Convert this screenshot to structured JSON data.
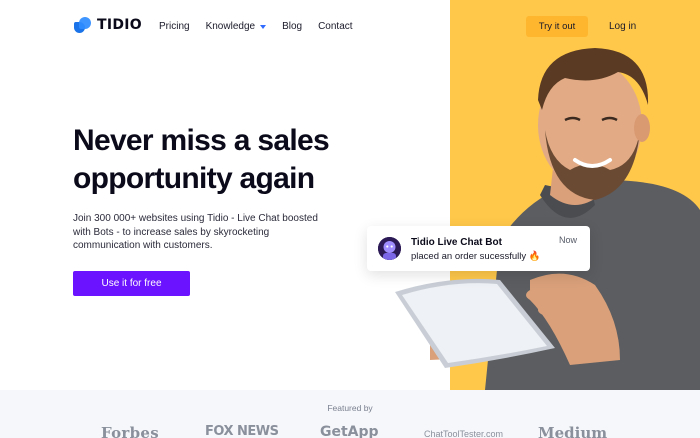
{
  "header": {
    "logo_text": "TIDIO",
    "nav": {
      "pricing": "Pricing",
      "knowledge": "Knowledge",
      "blog": "Blog",
      "contact": "Contact"
    },
    "try_label": "Try it out",
    "login_label": "Log in"
  },
  "hero": {
    "headline_line1": "Never miss a sales",
    "headline_line2": "opportunity again",
    "subtext": "Join 300 000+ websites using Tidio - Live Chat boosted with Bots - to increase sales by skyrocketing communication with customers.",
    "cta_label": "Use it for free"
  },
  "notification": {
    "title": "Tidio Live Chat Bot",
    "message": "placed an order sucessfully 🔥",
    "time": "Now"
  },
  "featured": {
    "label": "Featured by",
    "brands": [
      "Forbes",
      "FOX NEWS",
      "GetApp",
      "ChatToolTester.com",
      "Medium"
    ]
  },
  "colors": {
    "accent_yellow": "#ffc84a",
    "try_button": "#ffb62f",
    "cta_purple": "#6b12ff",
    "logo_blue": "#2f8cff"
  }
}
